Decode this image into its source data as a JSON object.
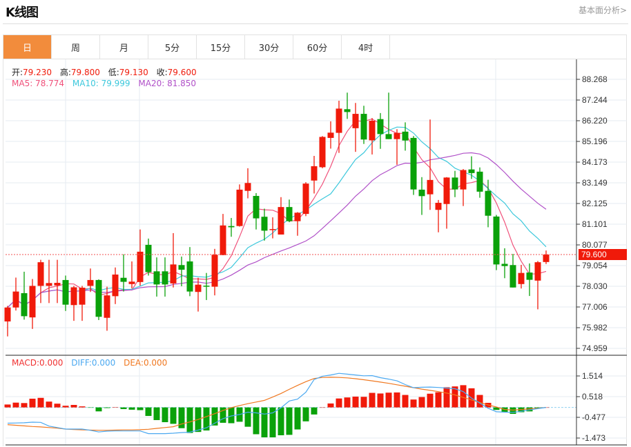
{
  "header": {
    "title": "K线图",
    "more_link": "基本面分析>"
  },
  "tabs": [
    "日",
    "周",
    "月",
    "5分",
    "15分",
    "30分",
    "60分",
    "4时"
  ],
  "active_tab": 0,
  "ohlc_legend": {
    "open_label": "开:",
    "open": "79.230",
    "high_label": "高:",
    "high": "79.800",
    "low_label": "低:",
    "low": "79.130",
    "close_label": "收:",
    "close": "79.600"
  },
  "ma_legend": {
    "ma5": "MA5: 78.774",
    "ma10": "MA10: 79.999",
    "ma20": "MA20: 81.850"
  },
  "macd_legend": {
    "macd": "MACD:0.000",
    "diff": "DIFF:0.000",
    "dea": "DEA:0.000"
  },
  "current_price_label": "79.600",
  "colors": {
    "up": "#f01a0a",
    "down": "#0aa10a",
    "ma5": "#f0507a",
    "ma10": "#3cc8dc",
    "ma20": "#b050c8",
    "diff": "#4aa8f0",
    "dea": "#f07820",
    "active_tab": "#f28c3c"
  },
  "chart_data": [
    {
      "type": "candlestick",
      "title": "K线图",
      "y_ticks": [
        "88.268",
        "87.244",
        "86.220",
        "85.196",
        "84.173",
        "83.149",
        "82.125",
        "81.101",
        "80.077",
        "79.054",
        "78.030",
        "77.006",
        "75.982",
        "74.959"
      ],
      "ylim": [
        74.959,
        88.268
      ],
      "current_price": 79.6,
      "ma_periods": [
        5,
        10,
        20
      ],
      "candles": [
        [
          76.29,
          77.06,
          75.55,
          76.98
        ],
        [
          76.98,
          78.46,
          76.83,
          77.77
        ],
        [
          77.69,
          78.75,
          76.38,
          76.55
        ],
        [
          76.49,
          78.39,
          75.92,
          78.05
        ],
        [
          78.05,
          79.34,
          77.2,
          79.22
        ],
        [
          78.05,
          79.34,
          77.2,
          78.19
        ],
        [
          78.07,
          79.34,
          77.2,
          78.2
        ],
        [
          78.34,
          78.56,
          76.81,
          77.12
        ],
        [
          77.1,
          78.05,
          76.32,
          77.98
        ],
        [
          77.12,
          78.05,
          76.32,
          77.96
        ],
        [
          78.05,
          78.91,
          77.75,
          78.34
        ],
        [
          78.34,
          78.37,
          76.36,
          76.52
        ],
        [
          76.47,
          78.01,
          75.83,
          77.58
        ],
        [
          77.54,
          78.96,
          77.15,
          78.61
        ],
        [
          78.45,
          79.61,
          77.77,
          78.25
        ],
        [
          78.14,
          79.26,
          77.92,
          78.26
        ],
        [
          78.24,
          80.84,
          78.06,
          79.74
        ],
        [
          80.08,
          80.39,
          78.56,
          78.73
        ],
        [
          78.77,
          79.46,
          77.52,
          78.12
        ],
        [
          78.77,
          79.46,
          77.52,
          78.12
        ],
        [
          78.17,
          80.66,
          77.97,
          79.11
        ],
        [
          79.08,
          79.5,
          78.03,
          78.85
        ],
        [
          79.26,
          79.97,
          77.54,
          77.77
        ],
        [
          77.75,
          78.45,
          76.78,
          78.11
        ],
        [
          78.06,
          78.69,
          77.35,
          78.01
        ],
        [
          78.01,
          79.88,
          77.58,
          79.59
        ],
        [
          79.57,
          81.61,
          79.57,
          81.04
        ],
        [
          81.01,
          81.41,
          80.48,
          80.95
        ],
        [
          81.01,
          83.07,
          80.98,
          82.81
        ],
        [
          82.75,
          83.87,
          82.38,
          83.14
        ],
        [
          82.5,
          82.64,
          80.84,
          81.39
        ],
        [
          81.47,
          81.87,
          80.29,
          80.78
        ],
        [
          80.82,
          81.44,
          80.4,
          80.86
        ],
        [
          80.59,
          82.44,
          80.59,
          81.95
        ],
        [
          81.95,
          82.32,
          81.2,
          81.25
        ],
        [
          81.25,
          81.7,
          80.53,
          81.67
        ],
        [
          81.61,
          83.18,
          81.5,
          83.11
        ],
        [
          83.26,
          84.48,
          82.62,
          83.97
        ],
        [
          83.92,
          85.46,
          83.87,
          85.42
        ],
        [
          85.37,
          86.19,
          84.84,
          85.63
        ],
        [
          85.62,
          87.21,
          84.63,
          86.82
        ],
        [
          86.79,
          87.61,
          86.31,
          86.65
        ],
        [
          85.85,
          87.1,
          84.68,
          86.56
        ],
        [
          86.56,
          86.96,
          85.07,
          85.29
        ],
        [
          85.25,
          86.35,
          84.55,
          86.22
        ],
        [
          86.3,
          86.6,
          84.83,
          85.56
        ],
        [
          85.56,
          87.61,
          85.31,
          85.31
        ],
        [
          85.31,
          85.8,
          84.04,
          85.62
        ],
        [
          85.68,
          86.14,
          84.74,
          85.24
        ],
        [
          85.37,
          85.46,
          82.55,
          82.82
        ],
        [
          82.81,
          83.43,
          81.56,
          82.49
        ],
        [
          82.58,
          86.28,
          81.81,
          83.29
        ],
        [
          81.81,
          82.3,
          80.7,
          82.16
        ],
        [
          82.1,
          83.43,
          80.88,
          83.41
        ],
        [
          83.41,
          83.74,
          82.44,
          82.82
        ],
        [
          82.82,
          83.83,
          82.0,
          83.78
        ],
        [
          83.81,
          84.46,
          83.34,
          83.63
        ],
        [
          83.7,
          83.91,
          82.41,
          82.71
        ],
        [
          82.75,
          83.3,
          80.95,
          81.52
        ],
        [
          81.48,
          81.56,
          78.83,
          79.11
        ],
        [
          79.14,
          79.91,
          78.43,
          79.03
        ],
        [
          79.08,
          79.63,
          77.97,
          77.97
        ],
        [
          78.14,
          79.09,
          77.92,
          78.69
        ],
        [
          78.71,
          79.16,
          77.55,
          78.35
        ],
        [
          78.31,
          79.28,
          76.89,
          79.22
        ],
        [
          79.23,
          79.8,
          79.13,
          79.6
        ]
      ]
    },
    {
      "type": "macd",
      "y_ticks": [
        "1.514",
        "0.518",
        "-0.477",
        "-1.473"
      ],
      "ylim": [
        -1.473,
        1.514
      ],
      "macd": [
        0.14,
        0.23,
        0.21,
        0.42,
        0.46,
        0.28,
        0.18,
        0.08,
        0.12,
        0.05,
        -0.01,
        -0.19,
        -0.03,
        0.01,
        -0.08,
        -0.11,
        -0.13,
        -0.41,
        -0.61,
        -0.71,
        -0.79,
        -1.0,
        -1.23,
        -1.18,
        -1.11,
        -0.87,
        -0.74,
        -0.76,
        -0.69,
        -0.93,
        -1.29,
        -1.44,
        -1.44,
        -1.34,
        -1.32,
        -1.06,
        -0.67,
        -0.34,
        0.0,
        0.19,
        0.43,
        0.48,
        0.52,
        0.51,
        0.7,
        0.67,
        0.71,
        0.72,
        0.6,
        0.38,
        0.5,
        0.66,
        0.73,
        0.97,
        1.01,
        1.07,
        0.92,
        0.6,
        0.22,
        -0.12,
        -0.21,
        -0.31,
        -0.23,
        -0.19,
        -0.03,
        0.0
      ],
      "diff": [
        -0.76,
        -0.75,
        -0.74,
        -0.71,
        -0.72,
        -0.9,
        -0.97,
        -1.04,
        -1.04,
        -1.04,
        -1.1,
        -1.18,
        -1.14,
        -1.13,
        -1.13,
        -1.13,
        -1.13,
        -1.26,
        -1.26,
        -1.26,
        -1.24,
        -1.21,
        -1.19,
        -1.09,
        -0.98,
        -0.76,
        -0.54,
        -0.41,
        -0.34,
        -0.23,
        -0.26,
        -0.32,
        -0.26,
        -0.02,
        0.31,
        0.4,
        0.73,
        1.34,
        1.5,
        1.56,
        1.64,
        1.6,
        1.56,
        1.52,
        1.53,
        1.43,
        1.36,
        1.28,
        1.1,
        0.95,
        0.97,
        0.98,
        0.96,
        0.93,
        0.9,
        0.76,
        0.45,
        0.21,
        -0.04,
        -0.21,
        -0.23,
        -0.24,
        -0.19,
        -0.12,
        -0.06,
        0.0
      ],
      "dea": [
        -0.83,
        -0.86,
        -0.89,
        -0.92,
        -0.94,
        -0.97,
        -1.0,
        -1.04,
        -1.06,
        -1.08,
        -1.09,
        -1.1,
        -1.1,
        -1.09,
        -1.08,
        -1.08,
        -1.07,
        -1.05,
        -1.01,
        -0.97,
        -0.93,
        -0.8,
        -0.7,
        -0.58,
        -0.44,
        -0.3,
        -0.15,
        -0.01,
        0.09,
        0.18,
        0.26,
        0.34,
        0.5,
        0.67,
        0.87,
        1.06,
        1.24,
        1.39,
        1.44,
        1.45,
        1.44,
        1.42,
        1.38,
        1.33,
        1.28,
        1.22,
        1.16,
        1.09,
        1.02,
        0.95,
        0.88,
        0.82,
        0.76,
        0.69,
        0.6,
        0.48,
        0.36,
        0.24,
        0.12,
        0.02,
        -0.1,
        -0.13,
        -0.1,
        -0.07,
        -0.04,
        0.0
      ]
    }
  ]
}
